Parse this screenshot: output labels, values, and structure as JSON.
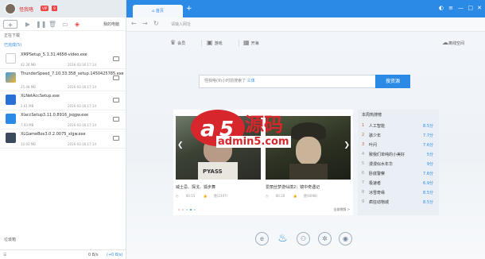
{
  "user": {
    "name": "怪我咯",
    "vip": "VIP",
    "badge": "9"
  },
  "left": {
    "device": "我的电脑",
    "downloading_label": "正在下载",
    "completed_label": "已完成",
    "completed_count": "(5)",
    "recycle_label": "垃圾箱",
    "files": [
      {
        "name": "XMPSetup_5.1.31.4658-video.exe",
        "size": "42.28 MB",
        "date": "2016-03-16 17:14"
      },
      {
        "name": "ThunderSpeed_7.10.33.358_setup.1450425785.exe",
        "size": "25.48 MB",
        "date": "2016-03-16 17:14"
      },
      {
        "name": "XLNetAccSetup.exe",
        "size": "2.61 MB",
        "date": "2016-03-16 17:14"
      },
      {
        "name": "XlaccSetup3.11.0.8916_jsqgw.exe",
        "size": "7.93 MB",
        "date": "2016-03-16 17:14"
      },
      {
        "name": "XLGameBox3.0.2.0075_xlgw.exe",
        "size": "10.92 MB",
        "date": "2016-03-16 17:14"
      }
    ],
    "speed": "0 B/s",
    "speed_up": "(+0 B/s)"
  },
  "browser": {
    "tab_label": "首页",
    "address_placeholder": "请输入网址",
    "quick": [
      "会员",
      "游戏",
      "开海"
    ],
    "space_label": "离线空间"
  },
  "search": {
    "placeholder_prefix": "怪我咯(9)小时前搜索了",
    "placeholder_hl": "三体",
    "button": "搜资源"
  },
  "carousel": {
    "cards": [
      {
        "title": "威士忌、探戈、狐步舞",
        "time": "00:15",
        "likes": "赞(2397)",
        "img_text": "PYASS"
      },
      {
        "title": "爱丽丝梦游仙境2：镜中奇遇记",
        "time": "00:20",
        "likes": "赞(6098)",
        "img_text": ""
      }
    ],
    "all_label": "全部视频 >"
  },
  "hot": {
    "title": "本周热搜榜",
    "items": [
      {
        "rank": "1",
        "name": "人工智能",
        "score": "8.5分"
      },
      {
        "rank": "2",
        "name": "骇少年",
        "score": "7.7分"
      },
      {
        "rank": "3",
        "name": "叶问",
        "score": "7.6分"
      },
      {
        "rank": "4",
        "name": "致我们单纯的小美好",
        "score": "5分"
      },
      {
        "rank": "5",
        "name": "漫漫似水年华",
        "score": "9分"
      },
      {
        "rank": "6",
        "name": "卧底警察",
        "score": "7.6分"
      },
      {
        "rank": "7",
        "name": "极速者",
        "score": "6.9分"
      },
      {
        "rank": "8",
        "name": "冰雪奇缘",
        "score": "8.5分"
      },
      {
        "rank": "9",
        "name": "疯狂动物城",
        "score": "8.5分"
      }
    ]
  },
  "watermark": {
    "brand": "a5源码",
    "site": "admin5.com"
  },
  "colors": {
    "accent": "#2a8ae6",
    "rank": "#e05a2a",
    "watermark": "#d7262c"
  }
}
